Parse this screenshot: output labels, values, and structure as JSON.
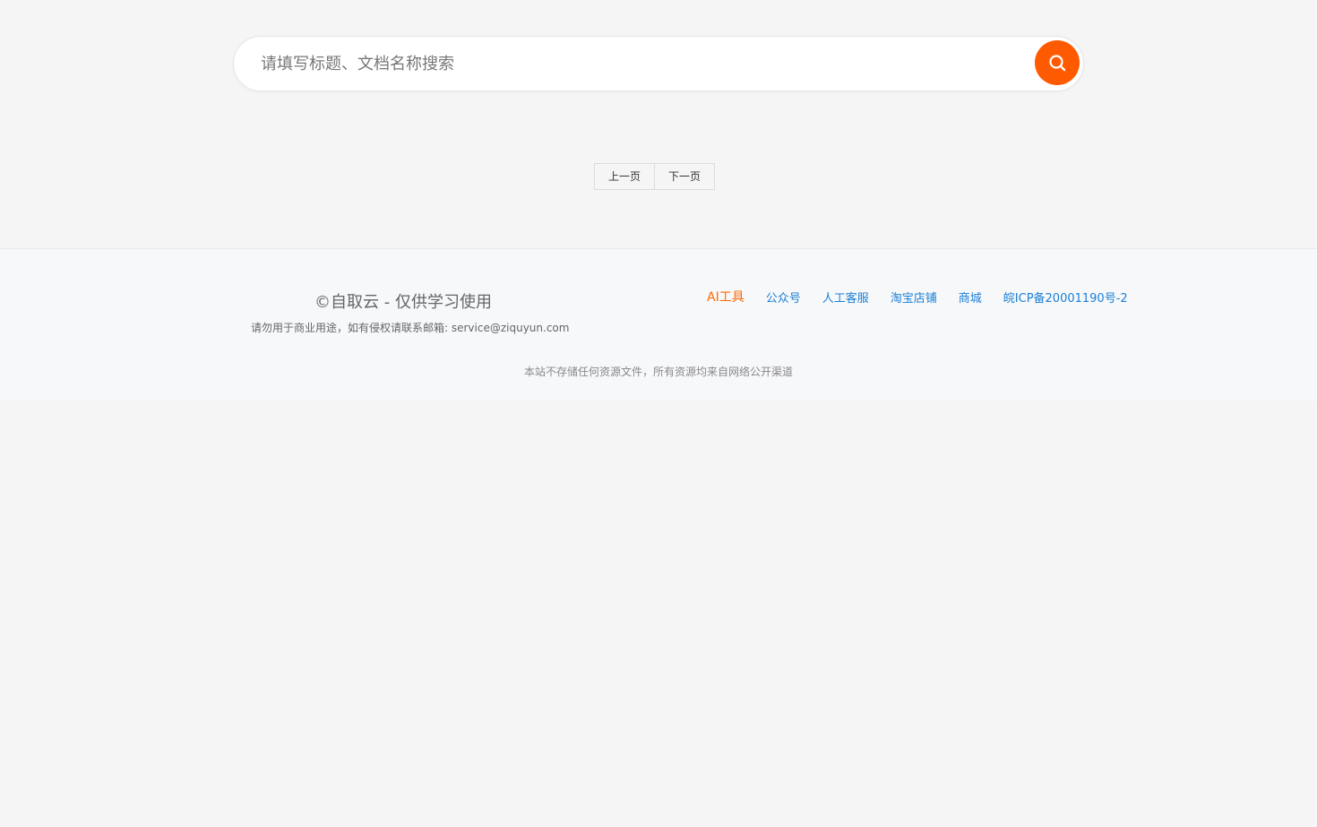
{
  "search": {
    "placeholder": "请填写标题、文档名称搜索",
    "button_icon": "search-icon",
    "button_color": "#ff5a00"
  },
  "pagination": {
    "prev_label": "上一页",
    "next_label": "下一页"
  },
  "footer": {
    "brand": "©自取云 - 仅供学习使用",
    "notice": "请勿用于商业用途，如有侵权请联系邮箱: service@ziquyun.com",
    "disclaimer": "本站不存储任何资源文件，所有资源均来自网络公开渠道",
    "links": [
      {
        "label": "AI工具",
        "color": "#ff6a00"
      },
      {
        "label": "公众号",
        "color": "#1a7fd6"
      },
      {
        "label": "人工客服",
        "color": "#1a7fd6"
      },
      {
        "label": "淘宝店铺",
        "color": "#1a7fd6"
      },
      {
        "label": "商城",
        "color": "#1a7fd6"
      },
      {
        "label": "皖ICP备20001190号-2",
        "color": "#1a7fd6"
      }
    ]
  }
}
